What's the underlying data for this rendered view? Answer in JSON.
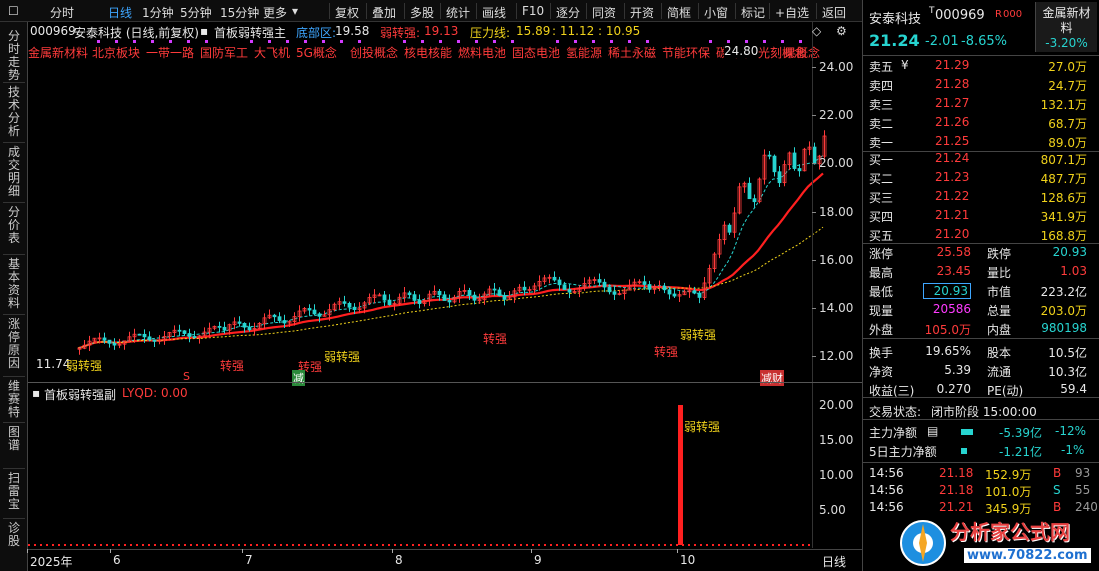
{
  "toolbar": {
    "left_items": [
      "分时",
      "日线",
      "1分钟",
      "5分钟",
      "15分钟",
      "更多"
    ],
    "active": "日线",
    "right_items": [
      "复权",
      "叠加",
      "多股",
      "统计",
      "画线",
      "F10",
      "逐分",
      "同资",
      "开资",
      "简框",
      "小窗",
      "标记",
      "+自选",
      "返回"
    ]
  },
  "left_tabs": [
    "分时走势",
    "技术分析",
    "成交明细",
    "分价表",
    "基本资料",
    "涨停原因",
    "维赛特",
    "图谱",
    "扫雷宝",
    "诊股"
  ],
  "main_chart": {
    "stock_code": "000969",
    "header": "安泰科技 (日线,前复权)",
    "indicator_name": "首板弱转强主",
    "bottom_label": "底部区:",
    "bottom_value": "19.58",
    "weak_label": "弱转强:",
    "weak_value": "19.13",
    "pressure_label": "压力线:",
    "pressure_value": "15.89",
    "ma_tail": ": 11.12 : 10.95",
    "concepts": [
      "金属新材料",
      "北京板块",
      "一带一路",
      "国防军工",
      "大飞机",
      "5G概念",
      "创投概念",
      "核电核能",
      "燃料电池",
      "固态电池",
      "氢能源",
      "稀土永磁",
      "节能环保",
      "碳纤维",
      "光刻概念"
    ],
    "concept_tail": "果概念",
    "high_label": "24.80",
    "low_label": "11.74",
    "y_ticks": [
      "24.00",
      "22.00",
      "20.00",
      "18.00",
      "16.00",
      "14.00",
      "12.00"
    ],
    "signals": [
      {
        "text": "弱转强"
      },
      {
        "text": "转强"
      },
      {
        "text": "转强"
      },
      {
        "text": "弱转强"
      },
      {
        "text": "转强"
      },
      {
        "text": "弱转强"
      },
      {
        "text": "转强"
      }
    ],
    "small_tags": [
      "S",
      "减",
      "减财"
    ]
  },
  "sub_chart": {
    "title": "首板弱转强副",
    "value_label": "LYQD: 0.00",
    "y_ticks": [
      "20.00",
      "15.00",
      "10.00",
      "5.00"
    ],
    "signal_label": "弱转强"
  },
  "x_axis": {
    "labels": [
      "2025年",
      "6",
      "7",
      "8",
      "9",
      "10"
    ],
    "period": "日线"
  },
  "right_panel": {
    "name": "安泰科技",
    "code": "000969",
    "badge": "R",
    "badge2": "000",
    "sector": "金属新材料",
    "sector_change": "-3.20%",
    "price": "21.24",
    "change": "-2.01",
    "change_pct": "-8.65%",
    "asks": [
      [
        "卖五",
        "21.29",
        "27.0万"
      ],
      [
        "卖四",
        "21.28",
        "24.7万"
      ],
      [
        "卖三",
        "21.27",
        "132.1万"
      ],
      [
        "卖二",
        "21.26",
        "68.7万"
      ],
      [
        "卖一",
        "21.25",
        "89.0万"
      ]
    ],
    "bids": [
      [
        "买一",
        "21.24",
        "807.1万"
      ],
      [
        "买二",
        "21.23",
        "487.7万"
      ],
      [
        "买三",
        "21.22",
        "128.6万"
      ],
      [
        "买四",
        "21.21",
        "341.9万"
      ],
      [
        "买五",
        "21.20",
        "168.8万"
      ]
    ],
    "stats": [
      [
        "涨停",
        "25.58",
        "跌停",
        "20.93"
      ],
      [
        "最高",
        "23.45",
        "量比",
        "1.03"
      ],
      [
        "最低",
        "20.93",
        "市值",
        "223.2亿"
      ],
      [
        "现量",
        "20586",
        "总量",
        "203.0万"
      ],
      [
        "外盘",
        "105.0万",
        "内盘",
        "980198"
      ],
      [
        "换手",
        "19.65%",
        "股本",
        "10.5亿"
      ],
      [
        "净资",
        "5.39",
        "流通",
        "10.3亿"
      ],
      [
        "收益(三)",
        "0.270",
        "PE(动)",
        "59.4"
      ]
    ],
    "trade_status_label": "交易状态:",
    "trade_status": "闭市阶段 15:00:00",
    "main_flow_label": "主力净额",
    "main_flow_value": "-5.39亿",
    "main_flow_pct": "-12%",
    "flow5_label": "5日主力净额",
    "flow5_value": "-1.21亿",
    "flow5_pct": "-1%",
    "ticks": [
      [
        "14:56",
        "21.18",
        "152.9万",
        "B",
        "93"
      ],
      [
        "14:56",
        "21.18",
        "101.0万",
        "S",
        "55"
      ],
      [
        "14:56",
        "21.21",
        "345.9万",
        "B",
        "240"
      ]
    ]
  },
  "watermark": {
    "brand": "分析家公式网",
    "url": "www.70822.com"
  },
  "colors": {
    "up": "#ff3b3b",
    "down": "#27d4d0",
    "ma_red": "#ff1f1f",
    "ma_yellow": "#f0d21b",
    "accent": "#3ea6ff"
  }
}
